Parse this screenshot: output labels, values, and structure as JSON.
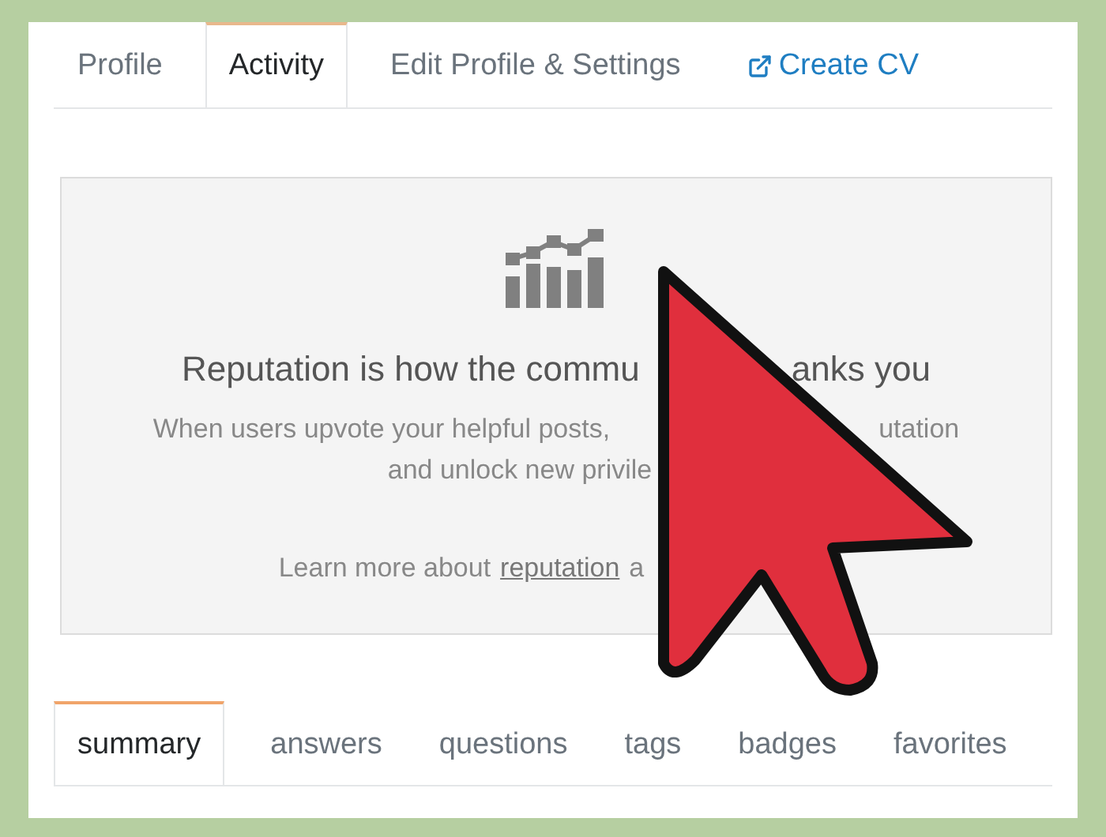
{
  "profile_tabs": [
    {
      "label": "Profile",
      "selected": false,
      "kind": "tab"
    },
    {
      "label": "Activity",
      "selected": true,
      "kind": "tab"
    },
    {
      "label": "Edit Profile & Settings",
      "selected": false,
      "kind": "tab"
    },
    {
      "label": "Create CV",
      "selected": false,
      "kind": "link"
    }
  ],
  "reputation_panel": {
    "heading": [
      "Reputation is how the commu",
      "anks you"
    ],
    "description": [
      [
        "When users upvote your helpful posts,",
        "utation"
      ],
      [
        "and unlock new privile"
      ]
    ],
    "learn_more": {
      "text": "Learn more about",
      "link": "reputation",
      "after": "a"
    }
  },
  "activity_tabs": [
    {
      "label": "summary",
      "selected": true
    },
    {
      "label": "answers",
      "selected": false
    },
    {
      "label": "questions",
      "selected": false
    },
    {
      "label": "tags",
      "selected": false
    },
    {
      "label": "badges",
      "selected": false
    },
    {
      "label": "favorites",
      "selected": false
    }
  ]
}
